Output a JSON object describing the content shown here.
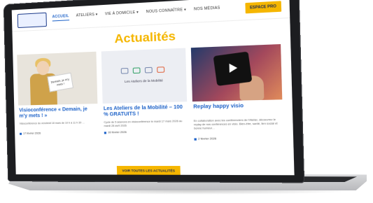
{
  "header": {
    "logo_text": "",
    "nav": [
      "ACCUEIL",
      "ATELIERS ▾",
      "VIE À DOMICILE ▾",
      "NOUS CONNAÎTRE ▾",
      "NOS MÉDIAS"
    ],
    "cta_label": "ESPACE PRO"
  },
  "page_title": "Actualités",
  "cards": [
    {
      "title": "Visioconférence « Demain, je m'y mets ! »",
      "desc": "Visioconférence du vendredi 18 mars de 10 h à 11 h 30 …",
      "date": "17 février 2026",
      "sign_text": "Demain, je m'y mets !"
    },
    {
      "title": "Les Ateliers de la Mobilité – 100 % GRATUITS !",
      "desc": "Cycle de 5 séances en visioconférence le mardi 17 mars 2026 au mardi 28 avril 2026",
      "date": "16 février 2026",
      "thumb_caption": "Les Ateliers de la Mobilité"
    },
    {
      "title": "Replay happy visio",
      "desc": "En collaboration avec les conférenciers de l'Atelier, découvrez le replay de nos conférences en visio. Bien-être, santé, lien social et bonne humeur…",
      "date": "2 février 2026"
    }
  ],
  "see_all_label": "VOIR TOUTES LES ACTUALITÉS",
  "colors": {
    "accent": "#f5b600",
    "link": "#1e63c9"
  }
}
